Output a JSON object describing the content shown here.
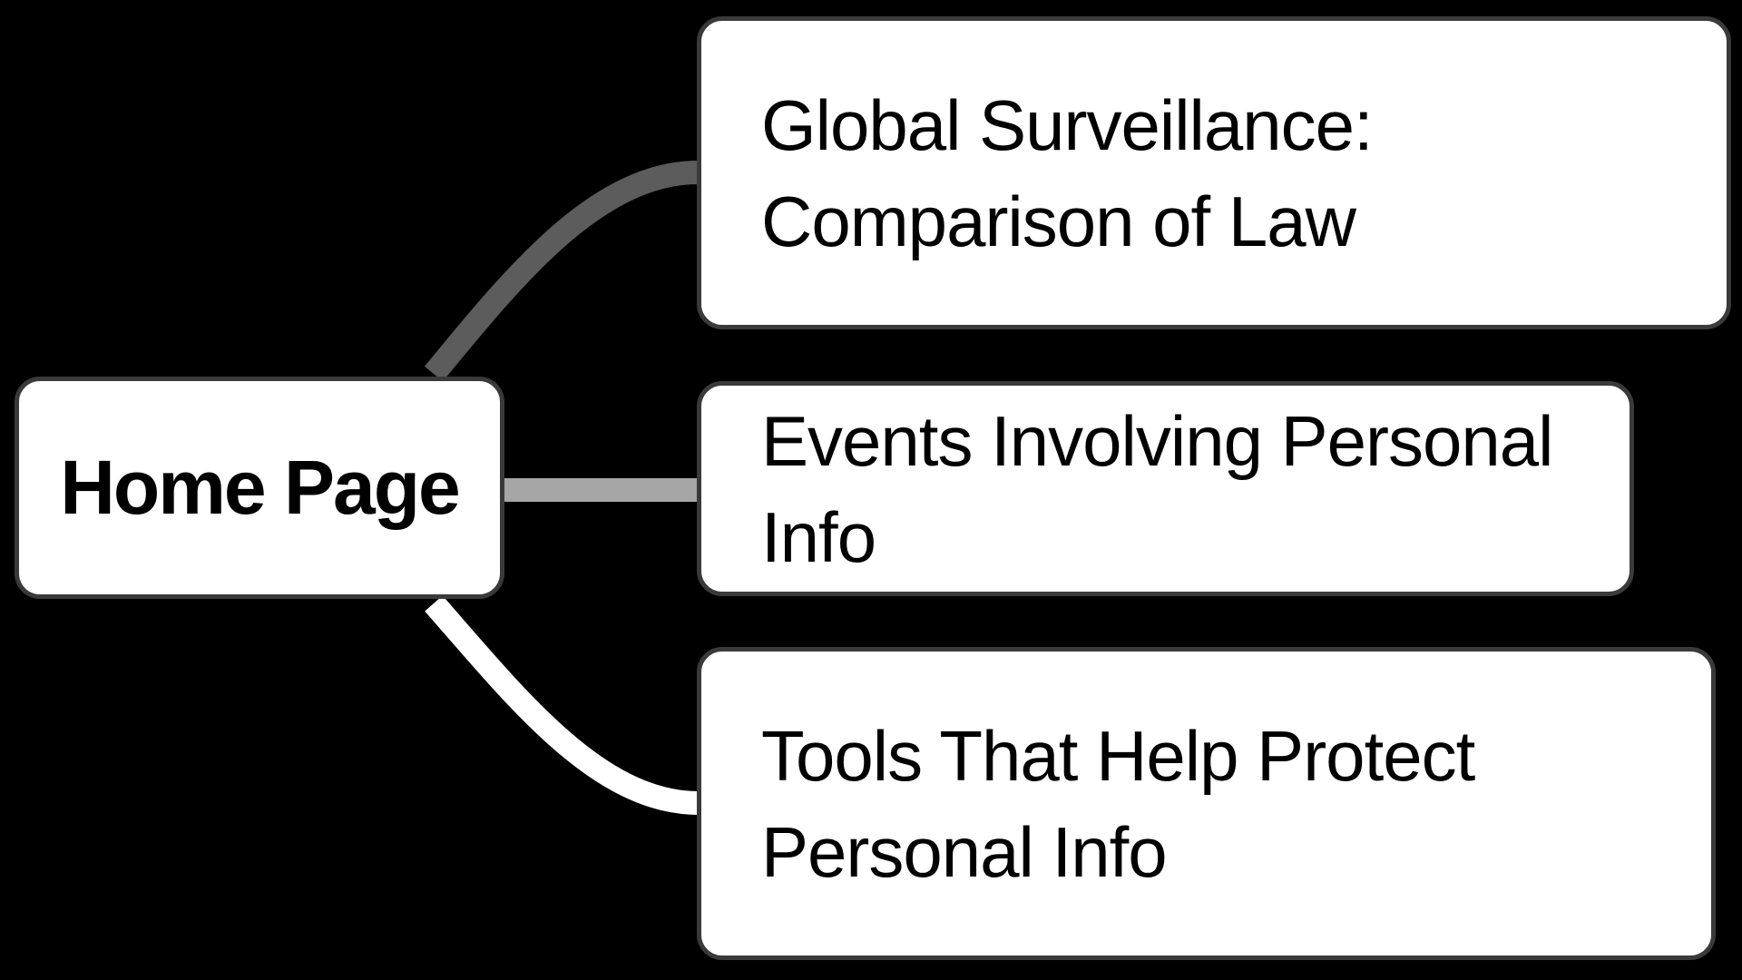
{
  "diagram": {
    "root": {
      "label": "Home Page"
    },
    "children": [
      {
        "label": "Global Surveillance: Comparison of Law",
        "edge_color": "#5c5c5c"
      },
      {
        "label": "Events Involving Personal Info",
        "edge_color": "#a6a6a6"
      },
      {
        "label": "Tools That Help Protect Personal Info",
        "edge_color": "#ffffff"
      }
    ]
  },
  "colors": {
    "background": "#000000",
    "node_fill": "#ffffff",
    "node_border": "#3a3a3a",
    "text": "#000000"
  }
}
